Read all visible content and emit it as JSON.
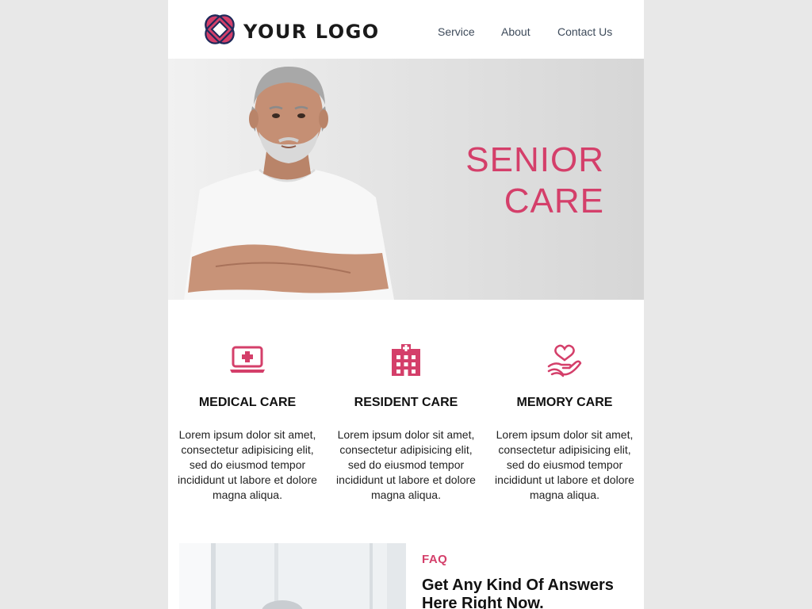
{
  "header": {
    "logo_text": "YOUR LOGO",
    "nav": [
      "Service",
      "About",
      "Contact Us"
    ]
  },
  "hero": {
    "title_line1": "SENIOR",
    "title_line2": "CARE"
  },
  "services": [
    {
      "icon": "laptop-medical-icon",
      "title": "MEDICAL CARE",
      "text": "Lorem ipsum dolor sit amet, consectetur adipisicing elit, sed do eiusmod tempor incididunt ut labore et dolore magna aliqua."
    },
    {
      "icon": "hospital-building-icon",
      "title": "RESIDENT CARE",
      "text": "Lorem ipsum dolor sit amet, consectetur adipisicing elit, sed do eiusmod tempor incididunt ut labore et dolore magna aliqua."
    },
    {
      "icon": "hand-holding-heart-icon",
      "title": "MEMORY CARE",
      "text": "Lorem ipsum dolor sit amet, consectetur adipisicing elit, sed do eiusmod tempor incididunt ut labore et dolore magna aliqua."
    }
  ],
  "faq": {
    "kicker": "FAQ",
    "heading": "Get Any Kind Of Answers Here Right Now."
  },
  "colors": {
    "accent": "#d43f6a",
    "navy": "#1f2a5a",
    "background": "#e8e8e8"
  }
}
